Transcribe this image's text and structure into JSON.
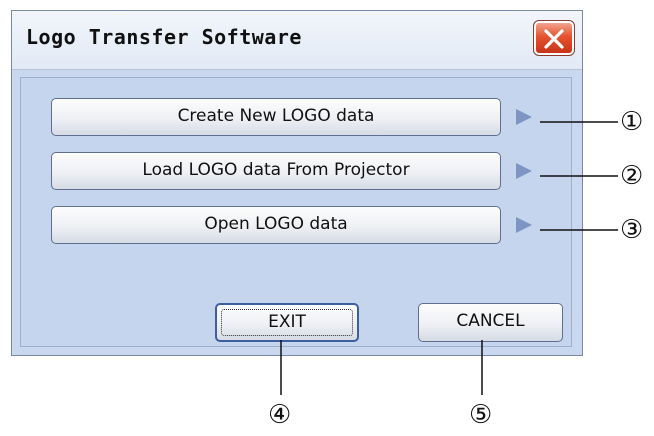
{
  "window": {
    "title": "Logo Transfer Software",
    "colors": {
      "client_bg": "#c5d5ee",
      "close_button": "#e5532f",
      "arrow": "#7e95c4"
    }
  },
  "buttons": {
    "create": "Create New LOGO data",
    "load": "Load LOGO data From Projector",
    "open": "Open LOGO data",
    "exit": "EXIT",
    "cancel": "CANCEL"
  },
  "callouts": {
    "c1": "①",
    "c2": "②",
    "c3": "③",
    "c4": "④",
    "c5": "⑤"
  }
}
